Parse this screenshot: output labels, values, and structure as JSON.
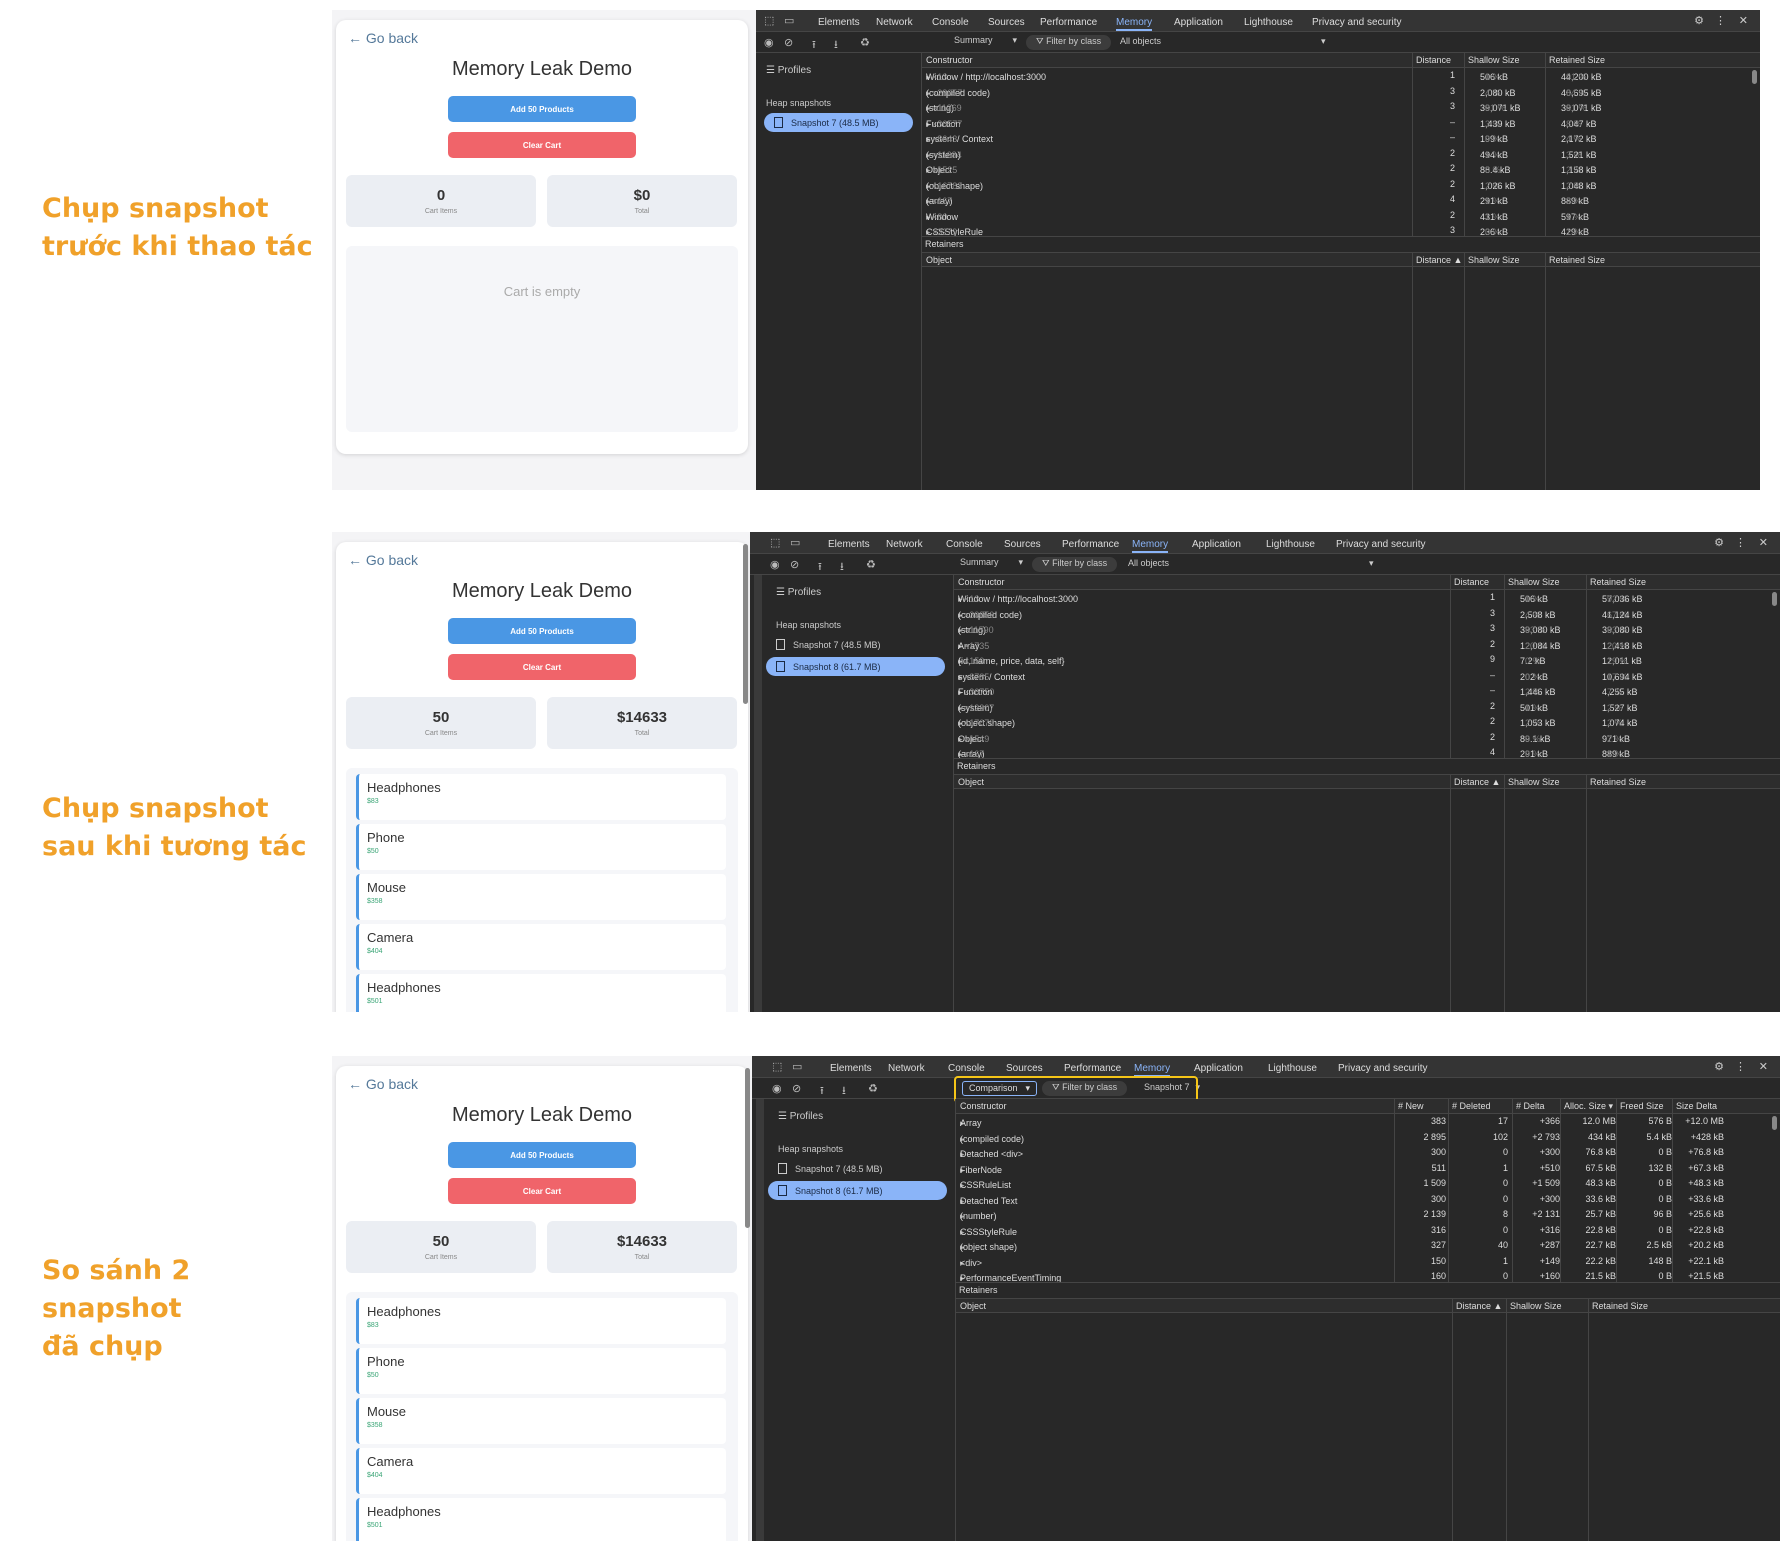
{
  "captions": [
    {
      "line1": "Chụp snapshot",
      "line2": "trước khi thao tác"
    },
    {
      "line1": "Chụp snapshot",
      "line2": "sau khi tương tác"
    },
    {
      "line1": "So sánh 2 snapshot",
      "line2": "đã chụp"
    }
  ],
  "app": {
    "go_back": "← Go back",
    "title": "Memory Leak Demo",
    "add_label": "Add 50 Products",
    "clear_label": "Clear Cart",
    "cart_items_label": "Cart Items",
    "total_label": "Total",
    "empty_text": "Cart is empty",
    "before": {
      "cart_items": "0",
      "total": "$0"
    },
    "after": {
      "cart_items": "50",
      "total": "$14633"
    },
    "items": [
      {
        "name": "Headphones",
        "price": "$83"
      },
      {
        "name": "Phone",
        "price": "$50"
      },
      {
        "name": "Mouse",
        "price": "$358"
      },
      {
        "name": "Camera",
        "price": "$404"
      },
      {
        "name": "Headphones",
        "price": "$501"
      }
    ]
  },
  "devtools": {
    "tabs": [
      "Elements",
      "Network",
      "Console",
      "Sources",
      "Performance",
      "Memory",
      "Application",
      "Lighthouse",
      "Privacy and security"
    ],
    "active_tab": "Memory",
    "profiles_label": "Profiles",
    "heap_snapshots_label": "Heap snapshots",
    "snapshot7": "Snapshot 7 (48.5 MB)",
    "snapshot8": "Snapshot 8 (61.7 MB)",
    "summary_label": "Summary",
    "comparison_label": "Comparison",
    "filter_label": "Filter by class",
    "all_objects": "All objects",
    "compare_target": "Snapshot 7",
    "retainers_label": "Retainers",
    "object_label": "Object",
    "summary_cols": [
      "Constructor",
      "Distance",
      "Shallow Size",
      "Retained Size"
    ],
    "retainer_cols": [
      "Object",
      "Distance ▲",
      "Shallow Size",
      "Retained Size"
    ],
    "comparison_cols": [
      "Constructor",
      "# New",
      "# Deleted",
      "# Delta",
      "Alloc. Size ▾",
      "Freed Size",
      "Size Delta"
    ]
  },
  "summary1": [
    {
      "name": "Window / http://localhost:3000",
      "count": "×13",
      "dist": "1",
      "shallow": "506 kB",
      "sp": "1 %",
      "retained": "44,200 kB",
      "rp": "91 %"
    },
    {
      "name": "(compiled code)",
      "count": "×28057",
      "dist": "3",
      "shallow": "2,080 kB",
      "sp": "4 %",
      "retained": "40,695 kB",
      "rp": "84 %"
    },
    {
      "name": "(string)",
      "count": "×11269",
      "dist": "3",
      "shallow": "39,071 kB",
      "sp": "81 %",
      "retained": "39,071 kB",
      "rp": "81 %"
    },
    {
      "name": "Function",
      "count": "×36577",
      "dist": "–",
      "shallow": "1,439 kB",
      "sp": "3 %",
      "retained": "4,047 kB",
      "rp": "8 %"
    },
    {
      "name": "system / Context",
      "count": "×8643",
      "dist": "–",
      "shallow": "199 kB",
      "sp": "0 %",
      "retained": "2,172 kB",
      "rp": "4 %"
    },
    {
      "name": "(system)",
      "count": "×11684",
      "dist": "2",
      "shallow": "494 kB",
      "sp": "1 %",
      "retained": "1,521 kB",
      "rp": "3 %"
    },
    {
      "name": "Object",
      "count": "×1525",
      "dist": "2",
      "shallow": "88.4 kB",
      "sp": "0 %",
      "retained": "1,158 kB",
      "rp": "2 %"
    },
    {
      "name": "(object shape)",
      "count": "×16783",
      "dist": "2",
      "shallow": "1,026 kB",
      "sp": "2 %",
      "retained": "1,048 kB",
      "rp": "2 %"
    },
    {
      "name": "(array)",
      "count": "×167",
      "dist": "4",
      "shallow": "291 kB",
      "sp": "1 %",
      "retained": "889 kB",
      "rp": "2 %"
    },
    {
      "name": "Window",
      "count": "×80",
      "dist": "2",
      "shallow": "431 kB",
      "sp": "1 %",
      "retained": "597 kB",
      "rp": "1 %"
    },
    {
      "name": "CSSStyleRule",
      "count": "×3279",
      "dist": "3",
      "shallow": "236 kB",
      "sp": "0 %",
      "retained": "429 kB",
      "rp": "1 %"
    }
  ],
  "summary2": [
    {
      "name": "Window / http://localhost:3000",
      "count": "×13",
      "dist": "1",
      "shallow": "506 kB",
      "sp": "1 %",
      "retained": "57,036 kB",
      "rp": "92 %"
    },
    {
      "name": "(compiled code)",
      "count": "×30850",
      "dist": "3",
      "shallow": "2,508 kB",
      "sp": "4 %",
      "retained": "41,124 kB",
      "rp": "67 %"
    },
    {
      "name": "(string)",
      "count": "×11590",
      "dist": "3",
      "shallow": "39,080 kB",
      "sp": "63 %",
      "retained": "39,080 kB",
      "rp": "63 %"
    },
    {
      "name": "Array",
      "count": "×1735",
      "dist": "2",
      "shallow": "12,084 kB",
      "sp": "20 %",
      "retained": "12,418 kB",
      "rp": "20 %"
    },
    {
      "name": "{id, name, price, data, self}",
      "count": "×150",
      "dist": "9",
      "shallow": "7.2 kB",
      "sp": "0 %",
      "retained": "12,011 kB",
      "rp": "19 %"
    },
    {
      "name": "system / Context",
      "count": "×8785",
      "dist": "–",
      "shallow": "202 kB",
      "sp": "0 %",
      "retained": "10,694 kB",
      "rp": "17 %"
    },
    {
      "name": "Function",
      "count": "×36750",
      "dist": "–",
      "shallow": "1,446 kB",
      "sp": "2 %",
      "retained": "4,255 kB",
      "rp": "7 %"
    },
    {
      "name": "(system)",
      "count": "×12207",
      "dist": "2",
      "shallow": "501 kB",
      "sp": "1 %",
      "retained": "1,527 kB",
      "rp": "2 %"
    },
    {
      "name": "(object shape)",
      "count": "×17070",
      "dist": "2",
      "shallow": "1,053 kB",
      "sp": "2 %",
      "retained": "1,074 kB",
      "rp": "2 %"
    },
    {
      "name": "Object",
      "count": "×1549",
      "dist": "2",
      "shallow": "89.1 kB",
      "sp": "0 %",
      "retained": "971 kB",
      "rp": "2 %"
    },
    {
      "name": "(array)",
      "count": "×167",
      "dist": "4",
      "shallow": "291 kB",
      "sp": "0 %",
      "retained": "889 kB",
      "rp": "1 %"
    }
  ],
  "comparison": [
    {
      "name": "Array",
      "new": "383",
      "del": "17",
      "delta": "+366",
      "alloc": "12.0 MB",
      "freed": "576 B",
      "sizedelta": "+12.0 MB"
    },
    {
      "name": "(compiled code)",
      "new": "2 895",
      "del": "102",
      "delta": "+2 793",
      "alloc": "434 kB",
      "freed": "5.4 kB",
      "sizedelta": "+428 kB"
    },
    {
      "name": "Detached <div>",
      "new": "300",
      "del": "0",
      "delta": "+300",
      "alloc": "76.8 kB",
      "freed": "0 B",
      "sizedelta": "+76.8 kB"
    },
    {
      "name": "FiberNode",
      "new": "511",
      "del": "1",
      "delta": "+510",
      "alloc": "67.5 kB",
      "freed": "132 B",
      "sizedelta": "+67.3 kB"
    },
    {
      "name": "CSSRuleList",
      "new": "1 509",
      "del": "0",
      "delta": "+1 509",
      "alloc": "48.3 kB",
      "freed": "0 B",
      "sizedelta": "+48.3 kB"
    },
    {
      "name": "Detached Text",
      "new": "300",
      "del": "0",
      "delta": "+300",
      "alloc": "33.6 kB",
      "freed": "0 B",
      "sizedelta": "+33.6 kB"
    },
    {
      "name": "(number)",
      "new": "2 139",
      "del": "8",
      "delta": "+2 131",
      "alloc": "25.7 kB",
      "freed": "96 B",
      "sizedelta": "+25.6 kB"
    },
    {
      "name": "CSSStyleRule",
      "new": "316",
      "del": "0",
      "delta": "+316",
      "alloc": "22.8 kB",
      "freed": "0 B",
      "sizedelta": "+22.8 kB"
    },
    {
      "name": "(object shape)",
      "new": "327",
      "del": "40",
      "delta": "+287",
      "alloc": "22.7 kB",
      "freed": "2.5 kB",
      "sizedelta": "+20.2 kB"
    },
    {
      "name": "<div>",
      "new": "150",
      "del": "1",
      "delta": "+149",
      "alloc": "22.2 kB",
      "freed": "148 B",
      "sizedelta": "+22.1 kB"
    },
    {
      "name": "PerformanceEventTiming",
      "new": "160",
      "del": "0",
      "delta": "+160",
      "alloc": "21.5 kB",
      "freed": "0 B",
      "sizedelta": "+21.5 kB"
    }
  ],
  "colors": {
    "caption": "#f0a12a",
    "devtools_bg": "#282828",
    "accent": "#8ab4f8",
    "add_button": "#4a97e4",
    "clear_button": "#f0646a",
    "highlight_outline": "#f5c518"
  }
}
